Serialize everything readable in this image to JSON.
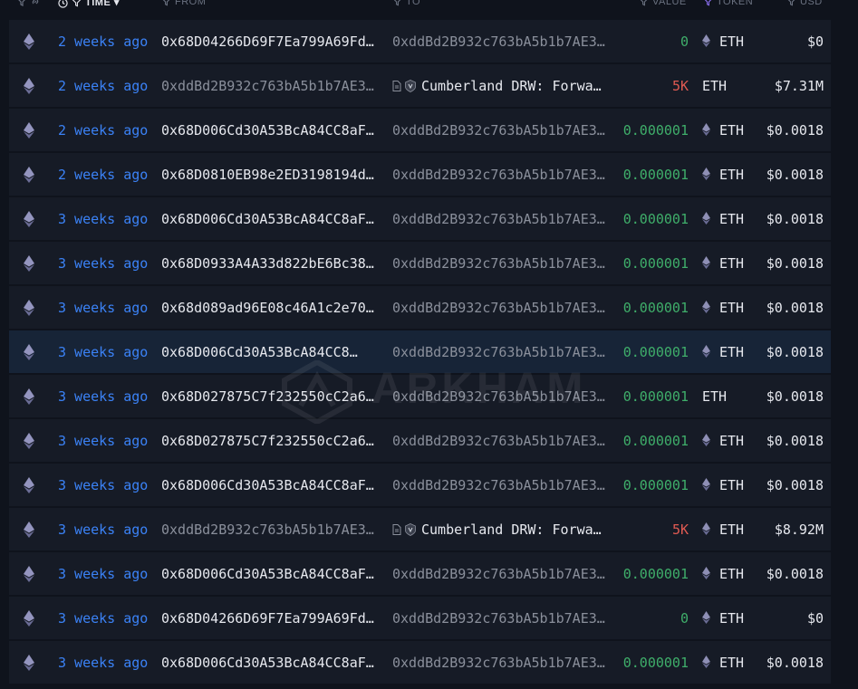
{
  "headers": {
    "time": "TIME",
    "from": "FROM",
    "to": "TO",
    "value": "VALUE",
    "token": "TOKEN",
    "usd": "USD"
  },
  "colors": {
    "link_blue": "#3b82f6",
    "value_green": "#3fae6a",
    "value_red": "#e05a52",
    "row_bg": "#161b26",
    "row_highlight": "#172437",
    "page_bg": "#0f131c"
  },
  "watermark": "ARKHAM",
  "rows": [
    {
      "time": "2 weeks ago",
      "from": "0x68D04266D69F7Ea799A69Fd…",
      "from_dim": false,
      "to": "0xddBd2B932c763bA5b1b7AE3…",
      "to_entity": false,
      "value": "0",
      "value_color": "green",
      "token": "ETH",
      "token_icon": true,
      "usd": "$0"
    },
    {
      "time": "2 weeks ago",
      "from": "0xddBd2B932c763bA5b1b7AE3…",
      "from_dim": true,
      "to": "Cumberland DRW: Forwa…",
      "to_entity": true,
      "value": "5K",
      "value_color": "red",
      "token": "ETH",
      "token_icon": false,
      "usd": "$7.31M"
    },
    {
      "time": "2 weeks ago",
      "from": "0x68D006Cd30A53BcA84CC8aF…",
      "from_dim": false,
      "to": "0xddBd2B932c763bA5b1b7AE3…",
      "to_entity": false,
      "value": "0.000001",
      "value_color": "green",
      "token": "ETH",
      "token_icon": true,
      "usd": "$0.0018"
    },
    {
      "time": "2 weeks ago",
      "from": "0x68D0810EB98e2ED3198194d…",
      "from_dim": false,
      "to": "0xddBd2B932c763bA5b1b7AE3…",
      "to_entity": false,
      "value": "0.000001",
      "value_color": "green",
      "token": "ETH",
      "token_icon": true,
      "usd": "$0.0018"
    },
    {
      "time": "3 weeks ago",
      "from": "0x68D006Cd30A53BcA84CC8aF…",
      "from_dim": false,
      "to": "0xddBd2B932c763bA5b1b7AE3…",
      "to_entity": false,
      "value": "0.000001",
      "value_color": "green",
      "token": "ETH",
      "token_icon": true,
      "usd": "$0.0018"
    },
    {
      "time": "3 weeks ago",
      "from": "0x68D0933A4A33d822bE6Bc38…",
      "from_dim": false,
      "to": "0xddBd2B932c763bA5b1b7AE3…",
      "to_entity": false,
      "value": "0.000001",
      "value_color": "green",
      "token": "ETH",
      "token_icon": true,
      "usd": "$0.0018"
    },
    {
      "time": "3 weeks ago",
      "from": "0x68d089ad96E08c46A1c2e70…",
      "from_dim": false,
      "to": "0xddBd2B932c763bA5b1b7AE3…",
      "to_entity": false,
      "value": "0.000001",
      "value_color": "green",
      "token": "ETH",
      "token_icon": true,
      "usd": "$0.0018"
    },
    {
      "time": "3 weeks ago",
      "from": "0x68D006Cd30A53BcA84CC8…",
      "from_dim": false,
      "to": "0xddBd2B932c763bA5b1b7AE3…",
      "to_entity": false,
      "value": "0.000001",
      "value_color": "green",
      "token": "ETH",
      "token_icon": true,
      "usd": "$0.0018",
      "highlight": true
    },
    {
      "time": "3 weeks ago",
      "from": "0x68D027875C7f232550cC2a6…",
      "from_dim": false,
      "to": "0xddBd2B932c763bA5b1b7AE3…",
      "to_entity": false,
      "value": "0.000001",
      "value_color": "green",
      "token": "ETH",
      "token_icon": false,
      "usd": "$0.0018"
    },
    {
      "time": "3 weeks ago",
      "from": "0x68D027875C7f232550cC2a6…",
      "from_dim": false,
      "to": "0xddBd2B932c763bA5b1b7AE3…",
      "to_entity": false,
      "value": "0.000001",
      "value_color": "green",
      "token": "ETH",
      "token_icon": true,
      "usd": "$0.0018"
    },
    {
      "time": "3 weeks ago",
      "from": "0x68D006Cd30A53BcA84CC8aF…",
      "from_dim": false,
      "to": "0xddBd2B932c763bA5b1b7AE3…",
      "to_entity": false,
      "value": "0.000001",
      "value_color": "green",
      "token": "ETH",
      "token_icon": true,
      "usd": "$0.0018"
    },
    {
      "time": "3 weeks ago",
      "from": "0xddBd2B932c763bA5b1b7AE3…",
      "from_dim": true,
      "to": "Cumberland DRW: Forwa…",
      "to_entity": true,
      "value": "5K",
      "value_color": "red",
      "token": "ETH",
      "token_icon": true,
      "usd": "$8.92M"
    },
    {
      "time": "3 weeks ago",
      "from": "0x68D006Cd30A53BcA84CC8aF…",
      "from_dim": false,
      "to": "0xddBd2B932c763bA5b1b7AE3…",
      "to_entity": false,
      "value": "0.000001",
      "value_color": "green",
      "token": "ETH",
      "token_icon": true,
      "usd": "$0.0018"
    },
    {
      "time": "3 weeks ago",
      "from": "0x68D04266D69F7Ea799A69Fd…",
      "from_dim": false,
      "to": "0xddBd2B932c763bA5b1b7AE3…",
      "to_entity": false,
      "value": "0",
      "value_color": "green",
      "token": "ETH",
      "token_icon": true,
      "usd": "$0"
    },
    {
      "time": "3 weeks ago",
      "from": "0x68D006Cd30A53BcA84CC8aF…",
      "from_dim": false,
      "to": "0xddBd2B932c763bA5b1b7AE3…",
      "to_entity": false,
      "value": "0.000001",
      "value_color": "green",
      "token": "ETH",
      "token_icon": true,
      "usd": "$0.0018"
    }
  ]
}
